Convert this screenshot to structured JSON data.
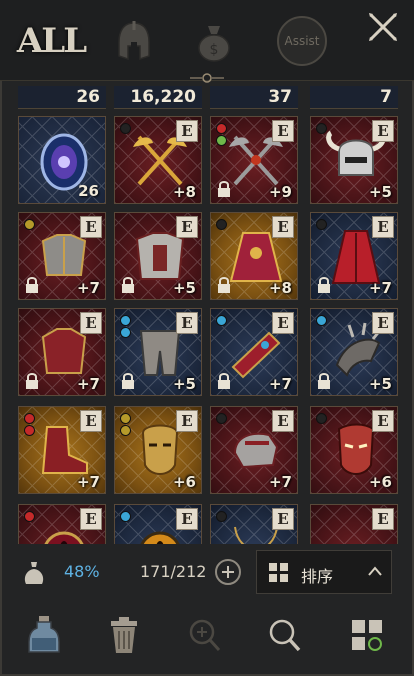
{
  "tabs": {
    "all_label": "ALL",
    "helmet_icon": "helmet-icon",
    "bag_icon": "money-bag-icon",
    "assist_label": "Assist",
    "close_icon": "close-icon"
  },
  "stack_row": [
    "26",
    "16,220",
    "37",
    "7"
  ],
  "items": [
    {
      "bg": "dark",
      "art": "jewel-disc",
      "count": "26",
      "equip": "",
      "level": "",
      "lock": false,
      "gems": [],
      "corner": "bag"
    },
    {
      "bg": "red",
      "art": "axes",
      "equip": "E",
      "level": "+8",
      "lock": false,
      "gems": [
        "#222"
      ]
    },
    {
      "bg": "red",
      "art": "axes-dark",
      "equip": "E",
      "level": "+9",
      "lock": true,
      "gems": [
        "#c42a2a",
        "#6fb84a"
      ]
    },
    {
      "bg": "red",
      "art": "horned-helmet",
      "equip": "E",
      "level": "+5",
      "lock": false,
      "gems": [
        "#222"
      ]
    },
    {
      "bg": "red",
      "art": "chest-armor",
      "equip": "E",
      "level": "+7",
      "lock": true,
      "gems": [
        "#b59a2a"
      ]
    },
    {
      "bg": "red",
      "art": "plate-armor",
      "equip": "E",
      "level": "+5",
      "lock": true,
      "gems": []
    },
    {
      "bg": "gold",
      "art": "robe",
      "equip": "E",
      "level": "+8",
      "lock": true,
      "gems": [
        "#222"
      ]
    },
    {
      "bg": "blue",
      "art": "red-robe",
      "equip": "E",
      "level": "+7",
      "lock": true,
      "gems": [
        "#222"
      ]
    },
    {
      "bg": "red",
      "art": "red-chest",
      "equip": "E",
      "level": "+7",
      "lock": true,
      "gems": []
    },
    {
      "bg": "blue",
      "art": "leg-armor",
      "equip": "E",
      "level": "+5",
      "lock": true,
      "gems": [
        "#3aa6d6",
        "#3aa6d6"
      ]
    },
    {
      "bg": "blue",
      "art": "bracer",
      "equip": "E",
      "level": "+7",
      "lock": true,
      "gems": [
        "#3aa6d6"
      ]
    },
    {
      "bg": "blue",
      "art": "spiked-bracer",
      "equip": "E",
      "level": "+5",
      "lock": true,
      "gems": [
        "#3aa6d6"
      ]
    },
    {
      "bg": "gold",
      "art": "boot",
      "equip": "E",
      "level": "+7",
      "lock": false,
      "gems": [
        "#c42a2a",
        "#c42a2a"
      ]
    },
    {
      "bg": "gold",
      "art": "golden-mask",
      "equip": "E",
      "level": "+6",
      "lock": false,
      "gems": [
        "#b59a2a",
        "#b59a2a"
      ]
    },
    {
      "bg": "red",
      "art": "gauntlet",
      "equip": "E",
      "level": "+7",
      "lock": false,
      "gems": [
        "#222"
      ]
    },
    {
      "bg": "red",
      "art": "demon-mask",
      "equip": "E",
      "level": "+6",
      "lock": false,
      "gems": [
        "#222"
      ]
    },
    {
      "bg": "red",
      "art": "red-eye",
      "equip": "E",
      "level": "",
      "lock": false,
      "gems": [
        "#c42a2a"
      ]
    },
    {
      "bg": "blue",
      "art": "gold-eye",
      "equip": "E",
      "level": "",
      "lock": false,
      "gems": [
        "#3aa6d6"
      ]
    },
    {
      "bg": "blue",
      "art": "necklace",
      "equip": "E",
      "level": "",
      "lock": false,
      "gems": [
        "#222"
      ]
    },
    {
      "bg": "red",
      "art": "belt",
      "equip": "E",
      "level": "",
      "lock": false,
      "gems": []
    }
  ],
  "status": {
    "capacity_pct": "48%",
    "capacity_count": "171/212",
    "sort_label": "排序"
  },
  "toolbar": [
    "potion-icon",
    "trash-icon",
    "zoom-in-icon",
    "search-icon",
    "layout-grid-icon"
  ]
}
